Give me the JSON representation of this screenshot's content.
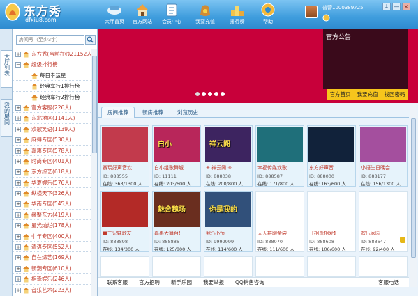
{
  "app": {
    "logo_text": "东方秀",
    "logo_sub": "dfxiu8.com"
  },
  "nav": [
    {
      "label": "大厅首页",
      "icon": "lobby-icon"
    },
    {
      "label": "官方网站",
      "icon": "home-icon"
    },
    {
      "label": "会员中心",
      "icon": "member-icon"
    },
    {
      "label": "我要充值",
      "icon": "money-bag-icon"
    },
    {
      "label": "排行榜",
      "icon": "ranking-icon"
    },
    {
      "label": "帮助",
      "icon": "help-icon"
    }
  ],
  "user": {
    "name": "普营1000389725"
  },
  "window_controls": [
    "↓",
    "―",
    "×"
  ],
  "left_tabs": [
    "大厅列表",
    "我的房间"
  ],
  "search": {
    "placeholder": "房间号（至少3字）"
  },
  "tree": [
    {
      "label": "东方秀",
      "count": "(当前在线21152人)",
      "level": 0,
      "color": "red"
    },
    {
      "label": "超级排行榜",
      "count": "",
      "level": 0,
      "color": "red"
    },
    {
      "label": "每日幸运星",
      "count": "",
      "level": 1,
      "color": "black"
    },
    {
      "label": "经典车行1排行榜",
      "count": "",
      "level": 1,
      "color": "black"
    },
    {
      "label": "经典车行2排行榜",
      "count": "",
      "level": 1,
      "color": "black"
    },
    {
      "label": "官方客服",
      "count": "(226人)",
      "level": 0,
      "color": "red"
    },
    {
      "label": "东北地区",
      "count": "(1141人)",
      "level": 0,
      "color": "red"
    },
    {
      "label": "欢歌笑语",
      "count": "(1139人)",
      "level": 0,
      "color": "red"
    },
    {
      "label": "麻得专区",
      "count": "(530人)",
      "level": 0,
      "color": "red"
    },
    {
      "label": "嘉惠专区",
      "count": "(578人)",
      "level": 0,
      "color": "red"
    },
    {
      "label": "时尚专区",
      "count": "(401人)",
      "level": 0,
      "color": "red"
    },
    {
      "label": "东方综艺",
      "count": "(618人)",
      "level": 0,
      "color": "red"
    },
    {
      "label": "华夏娱乐",
      "count": "(576人)",
      "level": 0,
      "color": "red"
    },
    {
      "label": "纵横天下",
      "count": "(326人)",
      "level": 0,
      "color": "red"
    },
    {
      "label": "华南专区",
      "count": "(545人)",
      "level": 0,
      "color": "red"
    },
    {
      "label": "缘聚东方",
      "count": "(419人)",
      "level": 0,
      "color": "red"
    },
    {
      "label": "星光灿烂",
      "count": "(178人)",
      "level": 0,
      "color": "red"
    },
    {
      "label": "中年专区",
      "count": "(400人)",
      "level": 0,
      "color": "red"
    },
    {
      "label": "清语专区",
      "count": "(552人)",
      "level": 0,
      "color": "red"
    },
    {
      "label": "自在综艺",
      "count": "(169人)",
      "level": 0,
      "color": "red"
    },
    {
      "label": "新潮专区",
      "count": "(610人)",
      "level": 0,
      "color": "red"
    },
    {
      "label": "相逢娱乐",
      "count": "(246人)",
      "level": 0,
      "color": "red"
    },
    {
      "label": "音乐艺术",
      "count": "(223人)",
      "level": 0,
      "color": "red"
    }
  ],
  "announcement": {
    "title": "官方公告",
    "buttons": [
      "官方首页",
      "我要充值",
      "找回密码"
    ]
  },
  "tabs": [
    "房间推荐",
    "新房推荐",
    "浏览历史"
  ],
  "rooms": [
    {
      "img_text": "",
      "name": "赛玥好声音欢",
      "id": "ID: 888555",
      "online": "在线: 363/1300 人",
      "bg": "#c23a4c"
    },
    {
      "img_text": "白小",
      "name": "白小组歌舞城",
      "id": "ID: 11111",
      "online": "在线: 203/600 人",
      "bg": "#b8265a"
    },
    {
      "img_text": "祥云阁",
      "name": "✳ 祥云阁 ✳",
      "id": "ID: 888038",
      "online": "在线: 200/800 人",
      "bg": "#3d2460"
    },
    {
      "img_text": "",
      "name": "幸福传媒欢歌",
      "id": "ID: 888587",
      "online": "在线: 171/800 人",
      "bg": "#1f6f7a"
    },
    {
      "img_text": "",
      "name": "东方好声音",
      "id": "ID: 888000",
      "online": "在线: 163/600 人",
      "bg": "#11223a"
    },
    {
      "img_text": "",
      "name": "小语生日晚会",
      "id": "ID: 888177",
      "online": "在线: 156/1300 人",
      "bg": "#a44f9e"
    },
    {
      "img_text": "",
      "name": "■三兄妹歌友",
      "id": "ID: 888898",
      "online": "在线: 134/300 人",
      "bg": "#b32a27"
    },
    {
      "img_text": "魅舍魏场",
      "name": "嘉惠大舞台!",
      "id": "ID: 888886",
      "online": "在线: 125/800 人",
      "bg": "#6a2e1f"
    },
    {
      "img_text": "你是我的",
      "name": "我○小恒",
      "id": "ID: 9999999",
      "online": "在线: 114/600 人",
      "bg": "#31507a"
    },
    {
      "img_text": "",
      "name": "天天群聊金袋",
      "id": "ID: 888070",
      "online": "在线: 111/600 人",
      "bg": "",
      "empty": true
    },
    {
      "img_text": "",
      "name": "【相逢相爱】",
      "id": "ID: 888608",
      "online": "在线: 106/600 人",
      "bg": "",
      "empty": true
    },
    {
      "img_text": "",
      "name": "欢乐家园",
      "id": "ID: 888647",
      "online": "在线: 92/400 人",
      "bg": "",
      "empty": true,
      "lock": true
    }
  ],
  "bottom_links": [
    "联系客服",
    "官方招聘",
    "新手乐园",
    "我要举报",
    "QQ销售咨询",
    "客服电话"
  ]
}
